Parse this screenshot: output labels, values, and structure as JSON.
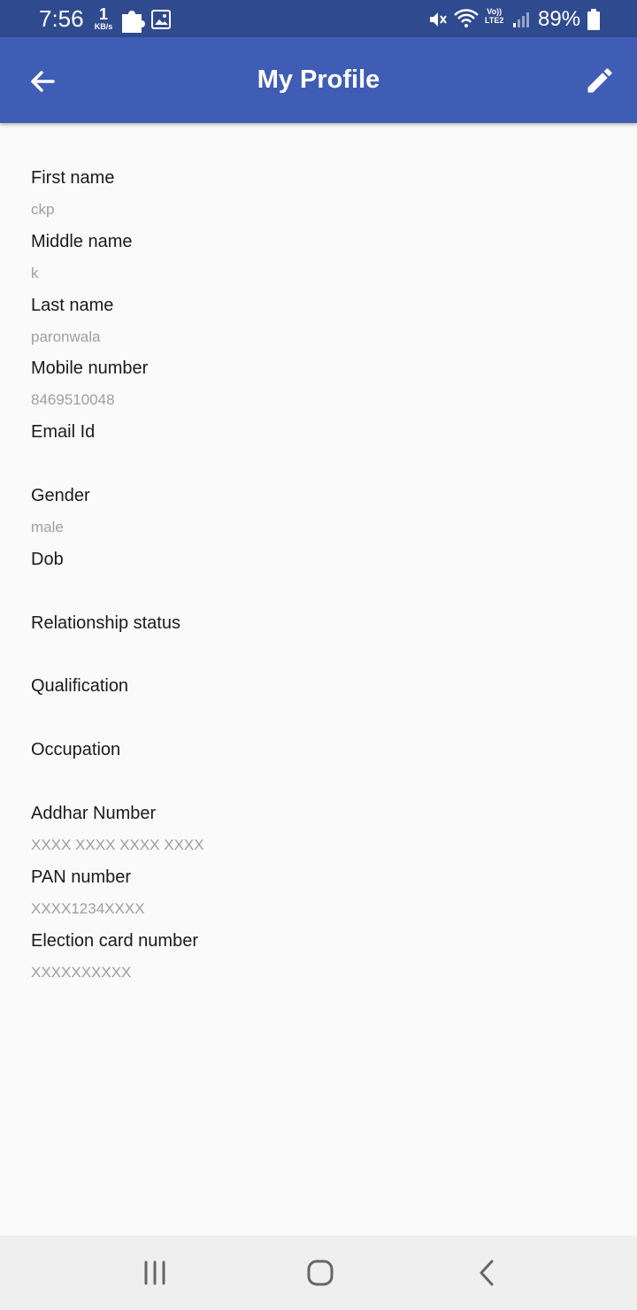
{
  "status_bar": {
    "time": "7:56",
    "speed_value": "1",
    "speed_unit": "KB/s",
    "network_label": "Vo))",
    "network_sub": "LTE2",
    "battery": "89%",
    "icons": [
      "puzzle-icon",
      "image-icon",
      "mute-icon",
      "wifi-icon",
      "signal-icon",
      "battery-icon"
    ]
  },
  "app_bar": {
    "title": "My Profile",
    "back_icon": "arrow-back-icon",
    "edit_icon": "pencil-edit-icon",
    "color": "#3f5db4"
  },
  "profile": {
    "fields": [
      {
        "label": "First name",
        "value": "ckp"
      },
      {
        "label": "Middle name",
        "value": "k"
      },
      {
        "label": "Last name",
        "value": "paronwala"
      },
      {
        "label": "Mobile number",
        "value": "8469510048"
      },
      {
        "label": "Email Id",
        "value": ""
      },
      {
        "label": "Gender",
        "value": "male"
      },
      {
        "label": "Dob",
        "value": ""
      },
      {
        "label": "Relationship status",
        "value": ""
      },
      {
        "label": "Qualification",
        "value": ""
      },
      {
        "label": "Occupation",
        "value": ""
      },
      {
        "label": "Addhar Number",
        "value": "XXXX XXXX XXXX XXXX"
      },
      {
        "label": "PAN number",
        "value": "XXXX1234XXXX"
      },
      {
        "label": "Election card number",
        "value": "XXXXXXXXXX"
      }
    ]
  },
  "nav_bar": {
    "icons": [
      "recent-apps-icon",
      "home-icon",
      "back-icon"
    ]
  }
}
